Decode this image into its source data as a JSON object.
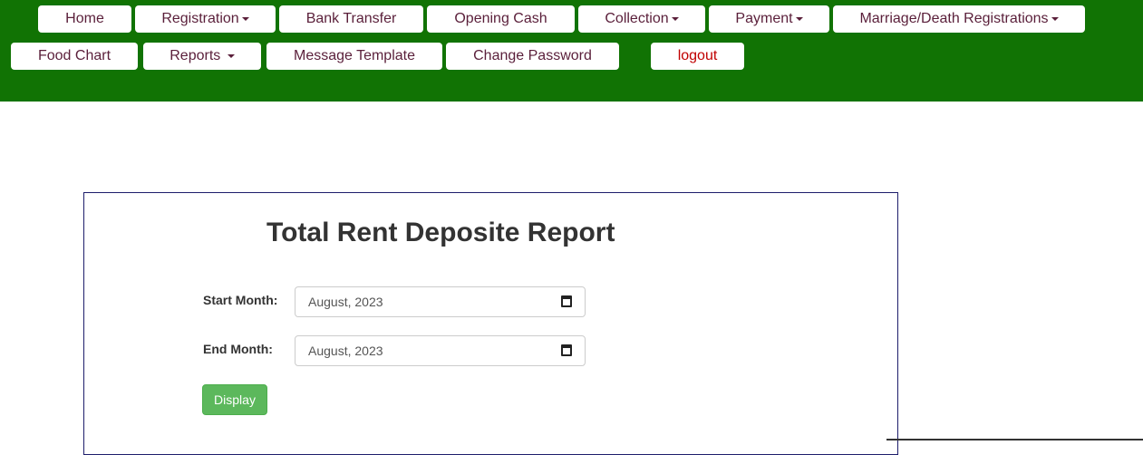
{
  "nav": {
    "home": "Home",
    "registration": "Registration",
    "bank_transfer": "Bank Transfer",
    "opening_cash": "Opening Cash",
    "collection": "Collection",
    "payment": "Payment",
    "marriage_death": "Marriage/Death Registrations",
    "food_chart": "Food Chart",
    "reports": "Reports",
    "message_template": "Message Template",
    "change_password": "Change Password",
    "logout": "logout"
  },
  "report": {
    "title": "Total Rent Deposite Report",
    "start_label": "Start Month:",
    "start_value": "August, 2023",
    "end_label": "End Month:",
    "end_value": "August, 2023",
    "display_label": "Display"
  },
  "colors": {
    "header_bg": "#117304",
    "nav_text": "#5a1f3a",
    "logout_text": "#c00000",
    "button_success": "#5cb85c"
  }
}
